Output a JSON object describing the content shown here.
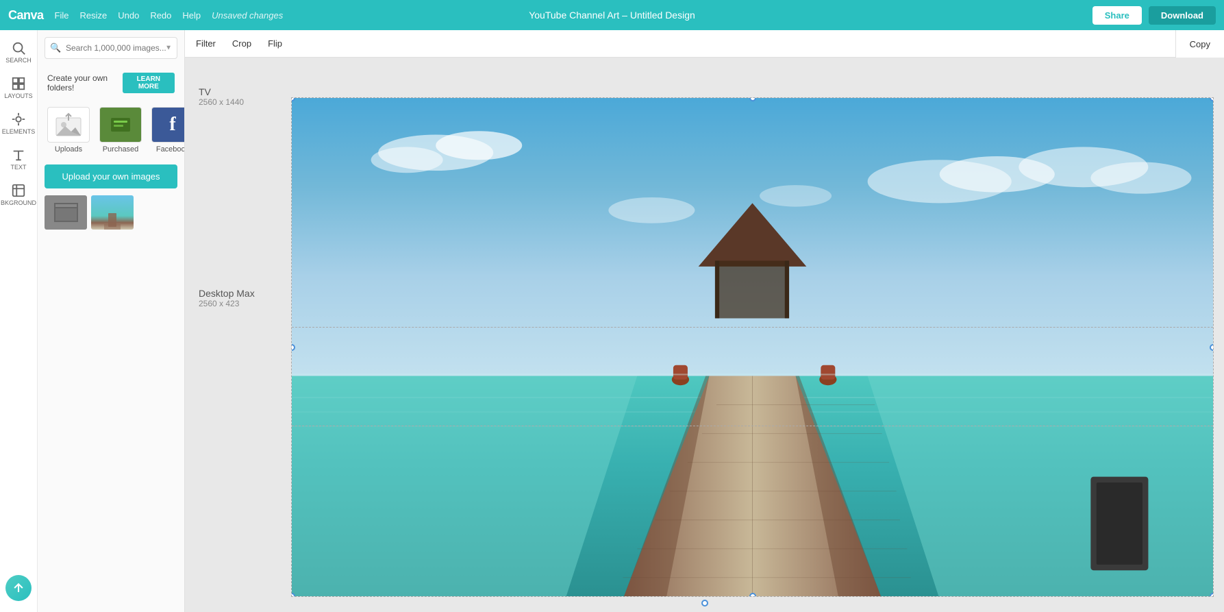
{
  "topbar": {
    "logo": "Canva",
    "menu": [
      "File",
      "Resize",
      "Undo",
      "Redo",
      "Help"
    ],
    "unsaved": "Unsaved changes",
    "title": "YouTube Channel Art – Untitled Design",
    "share_label": "Share",
    "download_label": "Download"
  },
  "secondary_toolbar": {
    "filter_label": "Filter",
    "crop_label": "Crop",
    "flip_label": "Flip",
    "copy_label": "Copy"
  },
  "left_panel": {
    "search_placeholder": "Search 1,000,000 images...",
    "folders_text": "Create your own folders!",
    "learn_more_label": "LEARN MORE",
    "sources": [
      {
        "id": "uploads",
        "label": "Uploads"
      },
      {
        "id": "purchased",
        "label": "Purchased"
      },
      {
        "id": "facebook",
        "label": "Facebook"
      }
    ],
    "upload_btn_label": "Upload your own images"
  },
  "icon_sidebar": {
    "items": [
      {
        "id": "search",
        "label": "SEARCH",
        "active": false
      },
      {
        "id": "layouts",
        "label": "LAYOUTS",
        "active": false
      },
      {
        "id": "elements",
        "label": "ELEMENTS",
        "active": false
      },
      {
        "id": "text",
        "label": "TEXT",
        "active": false
      },
      {
        "id": "background",
        "label": "BKGROUND",
        "active": false
      }
    ]
  },
  "canvas": {
    "tv_label": "TV",
    "tv_size": "2560 x 1440",
    "desktop_label": "Desktop Max",
    "desktop_size": "2560 x 423"
  }
}
